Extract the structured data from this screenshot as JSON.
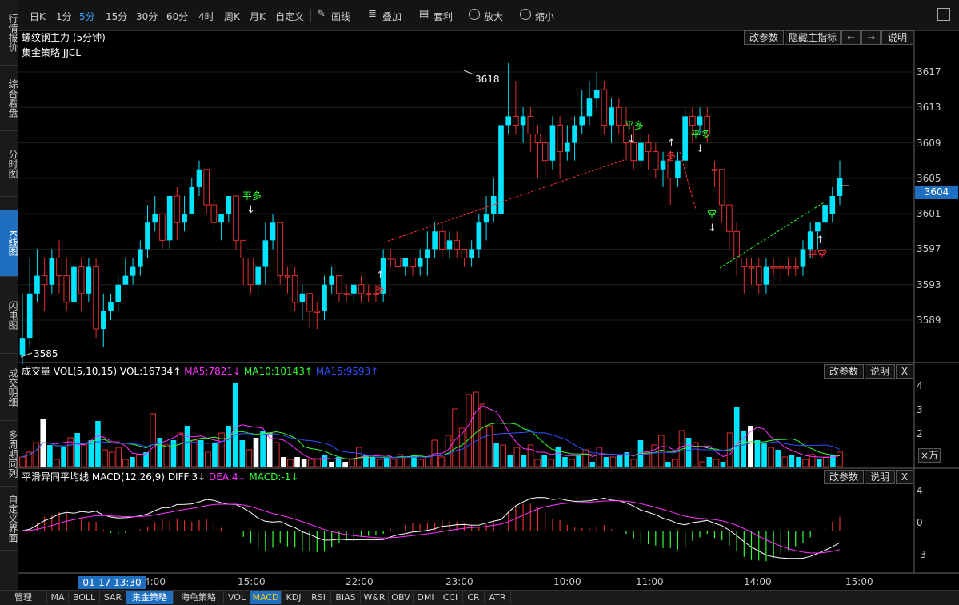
{
  "sidebar": {
    "tabs": [
      {
        "label": "行情报价"
      },
      {
        "label": "综合看盘"
      },
      {
        "label": "分时图"
      },
      {
        "label": "K线图",
        "active": true
      },
      {
        "label": "闪电图"
      },
      {
        "label": "成交明细"
      },
      {
        "label": "多周期同列"
      },
      {
        "label": "自定义界面"
      }
    ]
  },
  "toolbar": {
    "periods": [
      "日K",
      "1分",
      "5分",
      "15分",
      "30分",
      "60分",
      "4时",
      "周K",
      "月K",
      "自定义"
    ],
    "active_period": "5分",
    "tools": [
      "画线",
      "叠加",
      "套利",
      "放大",
      "缩小"
    ]
  },
  "main_panel": {
    "title": "螺纹钢主力 (5分钟)",
    "strategy": "集金策略 JJCL",
    "buttons": [
      "改参数",
      "隐藏主指标",
      "←",
      "→",
      "说明"
    ],
    "price_ticks": [
      "3617",
      "3613",
      "3609",
      "3605",
      "3601",
      "3597",
      "3593",
      "3589"
    ],
    "current_price": "3604",
    "high_label": "3618",
    "low_label": "3585",
    "signals": [
      "平多",
      "多",
      "平多",
      "多",
      "平多",
      "空",
      "平空"
    ]
  },
  "volume_panel": {
    "title": "成交量",
    "params": "VOL(5,10,15)",
    "vol": "VOL:16734↑",
    "ma5": "MA5:7821↓",
    "ma10": "MA10:10143↑",
    "ma15": "MA15:9593↑",
    "axis_ticks": [
      "4",
      "3",
      "2"
    ],
    "unit": "×万",
    "buttons": [
      "改参数",
      "说明",
      "X"
    ]
  },
  "macd_panel": {
    "title": "平滑异同平均线",
    "params": "MACD(12,26,9)",
    "diff": "DIFF:3↓",
    "dea": "DEA:4↓",
    "macd": "MACD:-1↓",
    "axis_ticks": [
      "4",
      "0",
      "-3"
    ],
    "buttons": [
      "改参数",
      "说明",
      "X"
    ]
  },
  "time_axis": {
    "cursor_label": "01-17 13:30",
    "labels": [
      "4:00",
      "15:00",
      "22:00",
      "23:00",
      "10:00",
      "11:00",
      "14:00",
      "15:00"
    ]
  },
  "bottom_tabs": [
    "管理",
    "MA",
    "BOLL",
    "SAR",
    "集金策略",
    "海龟策略",
    "VOL",
    "MACD",
    "KDJ",
    "RSI",
    "BIAS",
    "W&R",
    "OBV",
    "DMI",
    "CCI",
    "CR",
    "ATR"
  ],
  "colors": {
    "up": "#e03030",
    "down": "#00e5ff",
    "accent": "#1f6fc0",
    "ma5": "#ff30ff",
    "ma10": "#30ff30",
    "ma15": "#3050ff"
  },
  "chart_data": {
    "type": "candlestick",
    "title": "螺纹钢主力 (5分钟)",
    "ylim": [
      3584,
      3619
    ],
    "candles": [
      [
        3587,
        3592,
        3584,
        3585
      ],
      [
        3592,
        3596,
        3586,
        3587
      ],
      [
        3594,
        3597,
        3591,
        3592
      ],
      [
        3593,
        3596,
        3590,
        3594
      ],
      [
        3596,
        3597,
        3592,
        3593
      ],
      [
        3594,
        3598,
        3592,
        3596
      ],
      [
        3591,
        3596,
        3590,
        3594
      ],
      [
        3595,
        3596,
        3590,
        3591
      ],
      [
        3592,
        3596,
        3590,
        3595
      ],
      [
        3595,
        3596,
        3591,
        3592
      ],
      [
        3588,
        3596,
        3587,
        3595
      ],
      [
        3590,
        3592,
        3586,
        3588
      ],
      [
        3591,
        3592,
        3589,
        3590
      ],
      [
        3593,
        3594,
        3590,
        3591
      ],
      [
        3594,
        3596,
        3593,
        3593
      ],
      [
        3595,
        3596,
        3593,
        3594
      ],
      [
        3597,
        3598,
        3594,
        3595
      ],
      [
        3600,
        3602,
        3596,
        3597
      ],
      [
        3601,
        3603,
        3599,
        3600
      ],
      [
        3598,
        3601,
        3597,
        3601
      ],
      [
        3603,
        3603,
        3597,
        3598
      ],
      [
        3600,
        3604,
        3598,
        3603
      ],
      [
        3601,
        3603,
        3599,
        3600
      ],
      [
        3604,
        3605,
        3601,
        3601
      ],
      [
        3606,
        3607,
        3603,
        3604
      ],
      [
        3602,
        3606,
        3601,
        3606
      ],
      [
        3600,
        3603,
        3599,
        3602
      ],
      [
        3601,
        3601,
        3598,
        3600
      ],
      [
        3603,
        3603,
        3600,
        3601
      ],
      [
        3598,
        3603,
        3597,
        3603
      ],
      [
        3596,
        3598,
        3593,
        3598
      ],
      [
        3593,
        3596,
        3592,
        3596
      ],
      [
        3595,
        3595,
        3592,
        3593
      ],
      [
        3598,
        3600,
        3593,
        3595
      ],
      [
        3600,
        3601,
        3597,
        3598
      ],
      [
        3594,
        3600,
        3593,
        3600
      ],
      [
        3594,
        3595,
        3592,
        3594
      ],
      [
        3591,
        3595,
        3590,
        3594
      ],
      [
        3592,
        3593,
        3589,
        3591
      ],
      [
        3590,
        3592,
        3588,
        3592
      ],
      [
        3590,
        3591,
        3588,
        3590
      ],
      [
        3593,
        3594,
        3589,
        3590
      ],
      [
        3594,
        3595,
        3592,
        3593
      ],
      [
        3592,
        3594,
        3591,
        3594
      ],
      [
        3592,
        3593,
        3591,
        3592
      ],
      [
        3593,
        3593,
        3591,
        3592
      ],
      [
        3592,
        3594,
        3591,
        3593
      ],
      [
        3592,
        3593,
        3591,
        3592
      ],
      [
        3592,
        3593,
        3591,
        3592
      ],
      [
        3596,
        3597,
        3591,
        3592
      ],
      [
        3596,
        3597,
        3595,
        3596
      ],
      [
        3595,
        3597,
        3594,
        3596
      ],
      [
        3596,
        3596,
        3594,
        3595
      ],
      [
        3595,
        3596,
        3594,
        3596
      ],
      [
        3596,
        3597,
        3594,
        3595
      ],
      [
        3597,
        3599,
        3594,
        3596
      ],
      [
        3599,
        3600,
        3596,
        3597
      ],
      [
        3597,
        3600,
        3596,
        3599
      ],
      [
        3598,
        3599,
        3596,
        3597
      ],
      [
        3597,
        3599,
        3596,
        3598
      ],
      [
        3596,
        3597,
        3595,
        3597
      ],
      [
        3597,
        3598,
        3595,
        3596
      ],
      [
        3600,
        3601,
        3596,
        3597
      ],
      [
        3601,
        3603,
        3598,
        3600
      ],
      [
        3603,
        3605,
        3600,
        3601
      ],
      [
        3611,
        3612,
        3600,
        3601
      ],
      [
        3612,
        3618,
        3610,
        3611
      ],
      [
        3611,
        3616,
        3610,
        3612
      ],
      [
        3612,
        3613,
        3609,
        3611
      ],
      [
        3610,
        3613,
        3608,
        3612
      ],
      [
        3609,
        3611,
        3605,
        3610
      ],
      [
        3607,
        3610,
        3605,
        3609
      ],
      [
        3611,
        3612,
        3606,
        3607
      ],
      [
        3608,
        3612,
        3605,
        3611
      ],
      [
        3609,
        3611,
        3607,
        3608
      ],
      [
        3611,
        3612,
        3607,
        3609
      ],
      [
        3612,
        3615,
        3610,
        3611
      ],
      [
        3614,
        3616,
        3611,
        3612
      ],
      [
        3615,
        3617,
        3613,
        3614
      ],
      [
        3611,
        3616,
        3610,
        3615
      ],
      [
        3613,
        3614,
        3609,
        3611
      ],
      [
        3611,
        3614,
        3610,
        3613
      ],
      [
        3609,
        3613,
        3607,
        3611
      ],
      [
        3607,
        3611,
        3606,
        3609
      ],
      [
        3609,
        3610,
        3606,
        3607
      ],
      [
        3608,
        3610,
        3606,
        3609
      ],
      [
        3606,
        3609,
        3605,
        3608
      ],
      [
        3607,
        3608,
        3604,
        3606
      ],
      [
        3605,
        3608,
        3602,
        3607
      ],
      [
        3607,
        3608,
        3604,
        3605
      ],
      [
        3612,
        3613,
        3606,
        3607
      ],
      [
        3611,
        3613,
        3609,
        3612
      ],
      [
        3612,
        3613,
        3610,
        3611
      ],
      [
        3610,
        3613,
        3609,
        3612
      ],
      [
        3606,
        3607,
        3604,
        3606
      ],
      [
        3602,
        3606,
        3600,
        3606
      ],
      [
        3599,
        3602,
        3597,
        3602
      ],
      [
        3596,
        3600,
        3594,
        3599
      ],
      [
        3595,
        3596,
        3592,
        3596
      ],
      [
        3595,
        3596,
        3593,
        3595
      ],
      [
        3593,
        3596,
        3592,
        3595
      ],
      [
        3595,
        3596,
        3592,
        3593
      ],
      [
        3595,
        3596,
        3594,
        3595
      ],
      [
        3595,
        3596,
        3593,
        3595
      ],
      [
        3595,
        3596,
        3594,
        3595
      ],
      [
        3595,
        3596,
        3594,
        3595
      ],
      [
        3597,
        3598,
        3594,
        3595
      ],
      [
        3599,
        3600,
        3596,
        3597
      ],
      [
        3600,
        3600,
        3597,
        3599
      ],
      [
        3602,
        3603,
        3598,
        3600
      ],
      [
        3603,
        3604,
        3600,
        3601
      ],
      [
        3605,
        3607,
        3602,
        3603
      ]
    ],
    "volumes": [
      [
        0.4,
        "up"
      ],
      [
        0.6,
        "up"
      ],
      [
        1.0,
        "up"
      ],
      [
        2.0,
        "white"
      ],
      [
        0.9,
        "down"
      ],
      [
        0.3,
        "up"
      ],
      [
        0.8,
        "down"
      ],
      [
        1.2,
        "up"
      ],
      [
        1.4,
        "down"
      ],
      [
        0.9,
        "up"
      ],
      [
        1.1,
        "down"
      ],
      [
        1.9,
        "down"
      ],
      [
        0.7,
        "up"
      ],
      [
        0.6,
        "up"
      ],
      [
        0.8,
        "up"
      ],
      [
        0.3,
        "up"
      ],
      [
        0.4,
        "down"
      ],
      [
        0.5,
        "up"
      ],
      [
        0.6,
        "down"
      ],
      [
        2.2,
        "up"
      ],
      [
        1.2,
        "down"
      ],
      [
        0.9,
        "up"
      ],
      [
        1.1,
        "down"
      ],
      [
        1.4,
        "up"
      ],
      [
        1.7,
        "down"
      ],
      [
        1.1,
        "up"
      ],
      [
        1.1,
        "down"
      ],
      [
        0.6,
        "up"
      ],
      [
        1.0,
        "down"
      ],
      [
        1.4,
        "up"
      ],
      [
        1.7,
        "down"
      ],
      [
        3.5,
        "down"
      ],
      [
        1.1,
        "down"
      ],
      [
        0.7,
        "up"
      ],
      [
        1.2,
        "white"
      ],
      [
        1.5,
        "down"
      ],
      [
        1.4,
        "white"
      ],
      [
        1.0,
        "up"
      ],
      [
        0.4,
        "white"
      ],
      [
        0.3,
        "up"
      ],
      [
        0.4,
        "white"
      ],
      [
        0.3,
        "white"
      ],
      [
        0.3,
        "up"
      ],
      [
        0.3,
        "up"
      ],
      [
        0.5,
        "down"
      ],
      [
        0.2,
        "white"
      ],
      [
        0.4,
        "down"
      ],
      [
        0.2,
        "white"
      ],
      [
        0.3,
        "up"
      ],
      [
        0.8,
        "up"
      ],
      [
        0.5,
        "down"
      ],
      [
        0.4,
        "down"
      ],
      [
        0.3,
        "up"
      ],
      [
        0.4,
        "down"
      ],
      [
        0.3,
        "up"
      ],
      [
        0.5,
        "up"
      ],
      [
        0.4,
        "up"
      ],
      [
        0.5,
        "down"
      ],
      [
        0.3,
        "up"
      ],
      [
        0.4,
        "up"
      ],
      [
        1.1,
        "up"
      ],
      [
        0.4,
        "up"
      ],
      [
        1.3,
        "up"
      ],
      [
        2.4,
        "up"
      ],
      [
        1.6,
        "up"
      ],
      [
        3.0,
        "up"
      ],
      [
        3.1,
        "up"
      ],
      [
        2.6,
        "up"
      ],
      [
        1.7,
        "up"
      ],
      [
        1.0,
        "down"
      ],
      [
        0.9,
        "up"
      ],
      [
        0.5,
        "down"
      ],
      [
        0.8,
        "up"
      ],
      [
        0.5,
        "down"
      ],
      [
        0.9,
        "up"
      ],
      [
        0.3,
        "up"
      ],
      [
        0.5,
        "down"
      ],
      [
        0.3,
        "up"
      ],
      [
        0.8,
        "down"
      ],
      [
        0.4,
        "down"
      ],
      [
        0.3,
        "up"
      ],
      [
        0.5,
        "down"
      ],
      [
        0.7,
        "up"
      ],
      [
        0.2,
        "down"
      ],
      [
        0.8,
        "up"
      ],
      [
        0.4,
        "down"
      ],
      [
        0.4,
        "up"
      ],
      [
        0.5,
        "down"
      ],
      [
        0.6,
        "down"
      ],
      [
        0.3,
        "up"
      ],
      [
        1.1,
        "down"
      ],
      [
        0.6,
        "up"
      ],
      [
        0.9,
        "up"
      ],
      [
        1.3,
        "up"
      ],
      [
        0.2,
        "down"
      ],
      [
        0.3,
        "up"
      ],
      [
        1.5,
        "up"
      ],
      [
        1.2,
        "down"
      ],
      [
        1.0,
        "up"
      ],
      [
        0.2,
        "up"
      ],
      [
        0.4,
        "down"
      ],
      [
        0.3,
        "up"
      ],
      [
        0.2,
        "down"
      ],
      [
        1.4,
        "up"
      ],
      [
        2.5,
        "down"
      ],
      [
        1.5,
        "down"
      ],
      [
        1.7,
        "white"
      ],
      [
        1.1,
        "down"
      ],
      [
        1.0,
        "down"
      ],
      [
        0.8,
        "up"
      ],
      [
        0.7,
        "down"
      ],
      [
        0.4,
        "up"
      ],
      [
        0.5,
        "down"
      ],
      [
        0.4,
        "down"
      ],
      [
        0.3,
        "up"
      ],
      [
        0.5,
        "up"
      ],
      [
        0.3,
        "down"
      ],
      [
        0.4,
        "up"
      ],
      [
        0.5,
        "down"
      ],
      [
        0.6,
        "up"
      ]
    ]
  }
}
